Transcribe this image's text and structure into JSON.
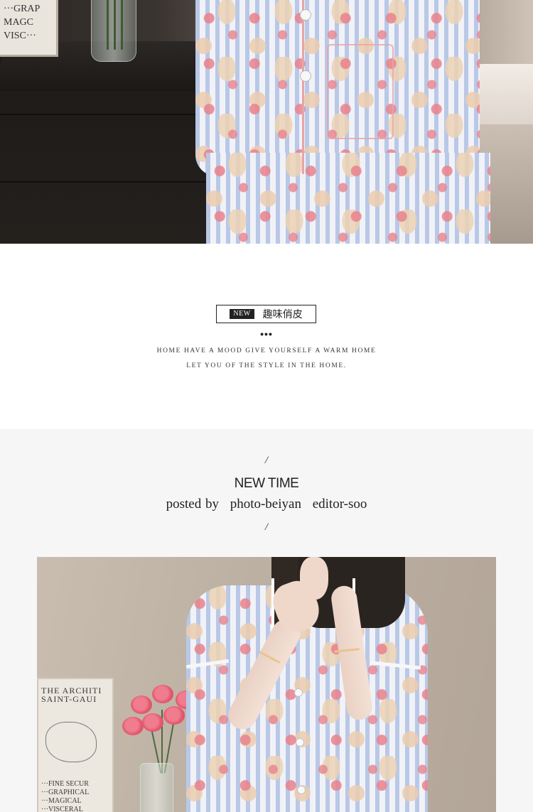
{
  "top_photo": {
    "poster_text": [
      "···GRAP",
      "MAGC",
      "VISC···"
    ]
  },
  "intro": {
    "badge": "NEW",
    "title": "趣味俏皮",
    "dots": "•••",
    "tagline_line1": "HOME HAVE A MOOD GIVE YOURSELF A WARM HOME",
    "tagline_line2": "LET YOU OF THE STYLE IN THE HOME."
  },
  "credits": {
    "slash_top": "/",
    "heading": "NEW TIME",
    "posted_by": "posted by",
    "photographer": "photo-beiyan",
    "editor": "editor-soo",
    "slash_bottom": "/"
  },
  "bottom_photo": {
    "poster_heading_1": "THE ARCHITI",
    "poster_heading_2": "SAINT-GAUI",
    "poster_lines": [
      "···FINE SECUR",
      "···GRAPHICAL",
      "···MAGICAL",
      "···VISCERAL"
    ]
  },
  "colors": {
    "page_background": "#ffffff",
    "section_background": "#f6f6f6",
    "text": "#222222",
    "badge_background": "#222222"
  }
}
